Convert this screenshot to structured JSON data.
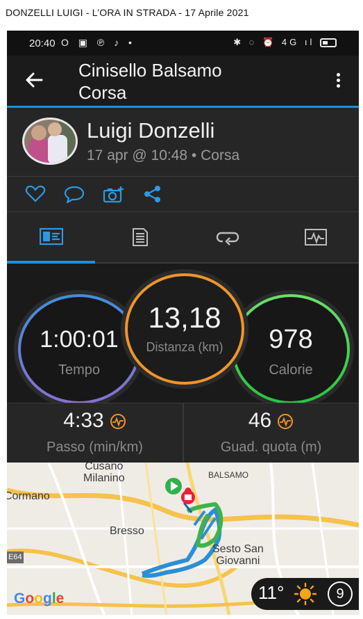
{
  "caption": "DONZELLI LUIGI  -  L’ORA IN STRADA  -  17 Aprile 2021",
  "status_bar": {
    "time": "20:40",
    "left_icons": "O ▣ ℗ ♪ •",
    "right_icons": "✱ ◌ ⏰ 4G ıl"
  },
  "app_bar": {
    "title_line1": "Cinisello Balsamo",
    "title_line2": "Corsa"
  },
  "profile": {
    "name": "Luigi Donzelli",
    "meta": "17 apr @ 10:48 • Corsa"
  },
  "action_icons": [
    "heart-icon",
    "comment-icon",
    "add-photo-icon",
    "share-icon"
  ],
  "tab_icons": [
    "stats-icon",
    "details-icon",
    "laps-icon",
    "chart-icon"
  ],
  "active_tab": 0,
  "stats": {
    "time": {
      "value": "1:00:01",
      "label": "Tempo",
      "color": "#7a73d6"
    },
    "distance": {
      "value": "13,18",
      "label": "Distanza (km)",
      "color": "#f0952a"
    },
    "calories": {
      "value": "978",
      "label": "Calorie",
      "color": "#2fd24a"
    }
  },
  "secondary": {
    "pace": {
      "value": "4:33",
      "label": "Passo (min/km)"
    },
    "elevation": {
      "value": "46",
      "label": "Guad. quota (m)"
    }
  },
  "map": {
    "labels": {
      "cusano": "Cusano\nMilanino",
      "balsamo": "BALSAMO",
      "cormano": "Cormano",
      "bresso": "Bresso",
      "sesto": "Sesto San\nGiovanni",
      "e64": "E64"
    },
    "google": "Google",
    "weather": {
      "temp": "11°",
      "count": "9"
    }
  },
  "colors": {
    "accent": "#1e8fd9",
    "orange": "#f0952a",
    "route": "#2a8fd6",
    "route_green": "#3fb24a"
  }
}
